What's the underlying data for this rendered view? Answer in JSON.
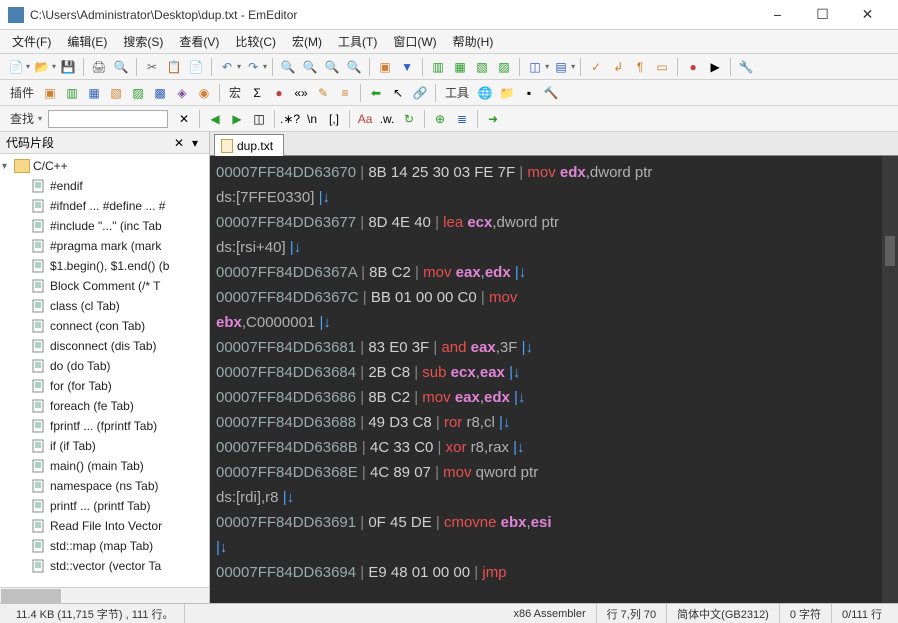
{
  "window": {
    "title": "C:\\Users\\Administrator\\Desktop\\dup.txt - EmEditor"
  },
  "menu": {
    "items": [
      "文件(F)",
      "编辑(E)",
      "搜索(S)",
      "查看(V)",
      "比较(C)",
      "宏(M)",
      "工具(T)",
      "窗口(W)",
      "帮助(H)"
    ]
  },
  "toolbar2": {
    "plugin_label": "插件",
    "macro_label": "宏",
    "tools_label": "工具"
  },
  "toolbar3": {
    "search_label": "查找"
  },
  "sidebar": {
    "title": "代码片段",
    "root": "C/C++",
    "items": [
      "#endif",
      "#ifndef ... #define ... #",
      "#include \"...\"  (inc Tab",
      "#pragma mark  (mark",
      "$1.begin(), $1.end()  (b",
      "Block Comment  (/* T",
      "class   (cl Tab)",
      "connect  (con Tab)",
      "disconnect  (dis Tab)",
      "do  (do Tab)",
      "for  (for Tab)",
      "foreach  (fe Tab)",
      "fprintf ...  (fprintf Tab)",
      "if  (if Tab)",
      "main()  (main Tab)",
      "namespace  (ns Tab)",
      "printf ...  (printf Tab)",
      "Read File Into Vector",
      "std::map  (map Tab)",
      "std::vector  (vector Ta"
    ]
  },
  "tab": {
    "name": "dup.txt"
  },
  "editor_lines": [
    [
      {
        "t": "addr",
        "v": "00007FF84DD63670"
      },
      {
        "t": "bar",
        "v": " | "
      },
      {
        "t": "bytes",
        "v": "8B 14 25 30 03 FE 7F"
      },
      {
        "t": "sp",
        "v": "            "
      },
      {
        "t": "op",
        "v": "| "
      },
      {
        "t": "mnemonic",
        "v": "mov "
      },
      {
        "t": "reg",
        "v": "edx"
      },
      {
        "t": "num",
        "v": ",dword ptr"
      }
    ],
    [
      {
        "t": "num",
        "v": "ds:[7FFE0330]"
      },
      {
        "t": "sp",
        "v": "       "
      },
      {
        "t": "wrap",
        "v": "|↓"
      }
    ],
    [
      {
        "t": "addr",
        "v": "00007FF84DD63677"
      },
      {
        "t": "bar",
        "v": " | "
      },
      {
        "t": "bytes",
        "v": "8D 4E 40"
      },
      {
        "t": "sp",
        "v": "                          "
      },
      {
        "t": "op",
        "v": "| "
      },
      {
        "t": "mnemonic",
        "v": "lea "
      },
      {
        "t": "reg",
        "v": "ecx"
      },
      {
        "t": "num",
        "v": ",dword ptr"
      }
    ],
    [
      {
        "t": "num",
        "v": "ds:[rsi+40]"
      },
      {
        "t": "sp",
        "v": "          "
      },
      {
        "t": "wrap",
        "v": "|↓"
      }
    ],
    [
      {
        "t": "addr",
        "v": "00007FF84DD6367A"
      },
      {
        "t": "bar",
        "v": " | "
      },
      {
        "t": "bytes",
        "v": "8B C2"
      },
      {
        "t": "sp",
        "v": "                               "
      },
      {
        "t": "op",
        "v": "| "
      },
      {
        "t": "mnemonic",
        "v": "mov "
      },
      {
        "t": "reg",
        "v": "eax"
      },
      {
        "t": "num",
        "v": ","
      },
      {
        "t": "reg",
        "v": "edx"
      },
      {
        "t": "sp",
        "v": "                          "
      },
      {
        "t": "wrap",
        "v": "|↓"
      }
    ],
    [
      {
        "t": "addr",
        "v": "00007FF84DD6367C"
      },
      {
        "t": "bar",
        "v": " | "
      },
      {
        "t": "bytes",
        "v": "BB 01 00 00 C0"
      },
      {
        "t": "sp",
        "v": "                   "
      },
      {
        "t": "op",
        "v": "| "
      },
      {
        "t": "mnemonic",
        "v": "mov"
      }
    ],
    [
      {
        "t": "reg",
        "v": "ebx"
      },
      {
        "t": "num",
        "v": ",C0000001"
      },
      {
        "t": "sp",
        "v": "                    "
      },
      {
        "t": "wrap",
        "v": "|↓"
      }
    ],
    [
      {
        "t": "addr",
        "v": "00007FF84DD63681"
      },
      {
        "t": "bar",
        "v": " | "
      },
      {
        "t": "bytes",
        "v": "83 E0 3F"
      },
      {
        "t": "sp",
        "v": "                           "
      },
      {
        "t": "op",
        "v": "| "
      },
      {
        "t": "mnemonic",
        "v": "and "
      },
      {
        "t": "reg",
        "v": "eax"
      },
      {
        "t": "num",
        "v": ",3F"
      },
      {
        "t": "sp",
        "v": "                              "
      },
      {
        "t": "wrap",
        "v": "|↓"
      }
    ],
    [
      {
        "t": "addr",
        "v": "00007FF84DD63684"
      },
      {
        "t": "bar",
        "v": " | "
      },
      {
        "t": "bytes",
        "v": "2B C8"
      },
      {
        "t": "sp",
        "v": "                               "
      },
      {
        "t": "op",
        "v": "| "
      },
      {
        "t": "mnemonic",
        "v": "sub "
      },
      {
        "t": "reg",
        "v": "ecx"
      },
      {
        "t": "num",
        "v": ","
      },
      {
        "t": "reg",
        "v": "eax"
      },
      {
        "t": "sp",
        "v": "                           "
      },
      {
        "t": "wrap",
        "v": "|↓"
      }
    ],
    [
      {
        "t": "addr",
        "v": "00007FF84DD63686"
      },
      {
        "t": "bar",
        "v": " | "
      },
      {
        "t": "bytes",
        "v": "8B C2"
      },
      {
        "t": "sp",
        "v": "                               "
      },
      {
        "t": "op",
        "v": "| "
      },
      {
        "t": "mnemonic",
        "v": "mov "
      },
      {
        "t": "reg",
        "v": "eax"
      },
      {
        "t": "num",
        "v": ","
      },
      {
        "t": "reg",
        "v": "edx"
      },
      {
        "t": "sp",
        "v": "                          "
      },
      {
        "t": "wrap",
        "v": "|↓"
      }
    ],
    [
      {
        "t": "addr",
        "v": "00007FF84DD63688"
      },
      {
        "t": "bar",
        "v": " | "
      },
      {
        "t": "bytes",
        "v": "49 D3 C8"
      },
      {
        "t": "sp",
        "v": "                            "
      },
      {
        "t": "op",
        "v": "| "
      },
      {
        "t": "mnemonic",
        "v": "ror "
      },
      {
        "t": "num",
        "v": "r8,cl"
      },
      {
        "t": "sp",
        "v": "                                  "
      },
      {
        "t": "wrap",
        "v": "|↓"
      }
    ],
    [
      {
        "t": "addr",
        "v": "00007FF84DD6368B"
      },
      {
        "t": "bar",
        "v": " | "
      },
      {
        "t": "bytes",
        "v": "4C 33 C0"
      },
      {
        "t": "sp",
        "v": "                            "
      },
      {
        "t": "op",
        "v": "| "
      },
      {
        "t": "mnemonic",
        "v": "xor "
      },
      {
        "t": "num",
        "v": "r8,rax"
      },
      {
        "t": "sp",
        "v": "                                "
      },
      {
        "t": "wrap",
        "v": "|↓"
      }
    ],
    [
      {
        "t": "addr",
        "v": "00007FF84DD6368E"
      },
      {
        "t": "bar",
        "v": " | "
      },
      {
        "t": "bytes",
        "v": "4C 89 07"
      },
      {
        "t": "sp",
        "v": "                            "
      },
      {
        "t": "op",
        "v": "| "
      },
      {
        "t": "mnemonic",
        "v": "mov "
      },
      {
        "t": "num",
        "v": "qword ptr"
      }
    ],
    [
      {
        "t": "num",
        "v": "ds:[rdi],r8"
      },
      {
        "t": "sp",
        "v": "           "
      },
      {
        "t": "wrap",
        "v": "|↓"
      }
    ],
    [
      {
        "t": "addr",
        "v": "00007FF84DD63691"
      },
      {
        "t": "bar",
        "v": " | "
      },
      {
        "t": "bytes",
        "v": "0F 45 DE"
      },
      {
        "t": "sp",
        "v": "                            "
      },
      {
        "t": "op",
        "v": "| "
      },
      {
        "t": "mnemonic",
        "v": "cmovne "
      },
      {
        "t": "reg",
        "v": "ebx"
      },
      {
        "t": "num",
        "v": ","
      },
      {
        "t": "reg",
        "v": "esi"
      }
    ],
    [
      {
        "t": "wrap",
        "v": "|↓"
      }
    ],
    [
      {
        "t": "addr",
        "v": "00007FF84DD63694"
      },
      {
        "t": "bar",
        "v": " | "
      },
      {
        "t": "bytes",
        "v": "E9 48 01 00 00"
      },
      {
        "t": "sp",
        "v": "                     "
      },
      {
        "t": "op",
        "v": "| "
      },
      {
        "t": "mnemonic",
        "v": "jmp"
      }
    ]
  ],
  "status": {
    "size": "11.4 KB (11,715 字节) , 111 行。",
    "lang": "x86 Assembler",
    "pos": "行 7,列 70",
    "enc": "简体中文(GB2312)",
    "sel": "0 字符",
    "lines": "0/111 行"
  }
}
